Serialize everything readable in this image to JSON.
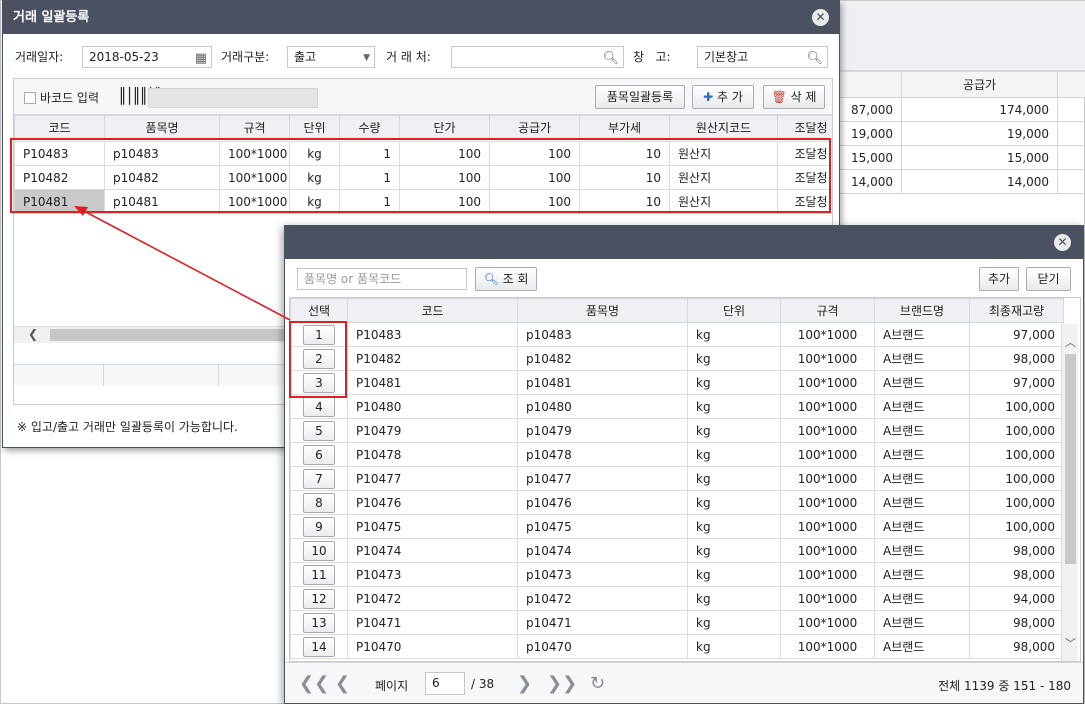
{
  "background": {
    "header": "공급가",
    "rows": [
      {
        "a": "87,000",
        "b": "174,000"
      },
      {
        "a": "19,000",
        "b": "19,000"
      },
      {
        "a": "15,000",
        "b": "15,000"
      },
      {
        "a": "14,000",
        "b": "14,000"
      }
    ]
  },
  "dialog1": {
    "title": "거래 일괄등록",
    "filters": {
      "date_label": "거래일자:",
      "date_value": "2018-05-23",
      "type_label": "거래구분:",
      "type_value": "출고",
      "partner_label": "거 래 처:",
      "partner_value": "",
      "warehouse_label": "창   고:",
      "warehouse_value": "기본창고"
    },
    "toolbar": {
      "barcode_label": "바코드 입력",
      "bulk_btn": "품목일괄등록",
      "add_btn": "추 가",
      "delete_btn": "삭 제"
    },
    "columns": [
      "코드",
      "품목명",
      "규격",
      "단위",
      "수량",
      "단가",
      "공급가",
      "부가세",
      "원산지코드",
      "조달청"
    ],
    "rows": [
      {
        "code": "P10483",
        "name": "p10483",
        "spec": "100*1000",
        "unit": "kg",
        "qty": "1",
        "price": "100",
        "supply": "100",
        "vat": "10",
        "origin": "원산지",
        "gov": "조달청"
      },
      {
        "code": "P10482",
        "name": "p10482",
        "spec": "100*1000",
        "unit": "kg",
        "qty": "1",
        "price": "100",
        "supply": "100",
        "vat": "10",
        "origin": "원산지",
        "gov": "조달청"
      },
      {
        "code": "P10481",
        "name": "p10481",
        "spec": "100*1000",
        "unit": "kg",
        "qty": "1",
        "price": "100",
        "supply": "100",
        "vat": "10",
        "origin": "원산지",
        "gov": "조달청"
      }
    ],
    "note": "※ 입고/출고 거래만 일괄등록이 가능합니다."
  },
  "dialog2": {
    "search_placeholder": "품목명 or 품목코드",
    "search_btn": "조 회",
    "add_btn": "추가",
    "close_btn": "닫기",
    "columns": [
      "선택",
      "코드",
      "품목명",
      "단위",
      "규격",
      "브랜드명",
      "최종재고량"
    ],
    "rows": [
      {
        "sel": "1",
        "code": "P10483",
        "name": "p10483",
        "unit": "kg",
        "spec": "100*1000",
        "brand": "A브랜드",
        "stock": "97,000"
      },
      {
        "sel": "2",
        "code": "P10482",
        "name": "p10482",
        "unit": "kg",
        "spec": "100*1000",
        "brand": "A브랜드",
        "stock": "98,000"
      },
      {
        "sel": "3",
        "code": "P10481",
        "name": "p10481",
        "unit": "kg",
        "spec": "100*1000",
        "brand": "A브랜드",
        "stock": "97,000"
      },
      {
        "sel": "4",
        "code": "P10480",
        "name": "p10480",
        "unit": "kg",
        "spec": "100*1000",
        "brand": "A브랜드",
        "stock": "100,000"
      },
      {
        "sel": "5",
        "code": "P10479",
        "name": "p10479",
        "unit": "kg",
        "spec": "100*1000",
        "brand": "A브랜드",
        "stock": "100,000"
      },
      {
        "sel": "6",
        "code": "P10478",
        "name": "p10478",
        "unit": "kg",
        "spec": "100*1000",
        "brand": "A브랜드",
        "stock": "100,000"
      },
      {
        "sel": "7",
        "code": "P10477",
        "name": "p10477",
        "unit": "kg",
        "spec": "100*1000",
        "brand": "A브랜드",
        "stock": "100,000"
      },
      {
        "sel": "8",
        "code": "P10476",
        "name": "p10476",
        "unit": "kg",
        "spec": "100*1000",
        "brand": "A브랜드",
        "stock": "100,000"
      },
      {
        "sel": "9",
        "code": "P10475",
        "name": "p10475",
        "unit": "kg",
        "spec": "100*1000",
        "brand": "A브랜드",
        "stock": "100,000"
      },
      {
        "sel": "10",
        "code": "P10474",
        "name": "p10474",
        "unit": "kg",
        "spec": "100*1000",
        "brand": "A브랜드",
        "stock": "98,000"
      },
      {
        "sel": "11",
        "code": "P10473",
        "name": "p10473",
        "unit": "kg",
        "spec": "100*1000",
        "brand": "A브랜드",
        "stock": "98,000"
      },
      {
        "sel": "12",
        "code": "P10472",
        "name": "p10472",
        "unit": "kg",
        "spec": "100*1000",
        "brand": "A브랜드",
        "stock": "94,000"
      },
      {
        "sel": "13",
        "code": "P10471",
        "name": "p10471",
        "unit": "kg",
        "spec": "100*1000",
        "brand": "A브랜드",
        "stock": "98,000"
      },
      {
        "sel": "14",
        "code": "P10470",
        "name": "p10470",
        "unit": "kg",
        "spec": "100*1000",
        "brand": "A브랜드",
        "stock": "98,000"
      }
    ],
    "pager": {
      "page_label": "페이지",
      "page_value": "6",
      "total_pages": "/ 38",
      "summary": "전체 1139 중 151 - 180"
    }
  },
  "colors": {
    "titlebar": "#4a5160",
    "highlight": "#e02020"
  }
}
